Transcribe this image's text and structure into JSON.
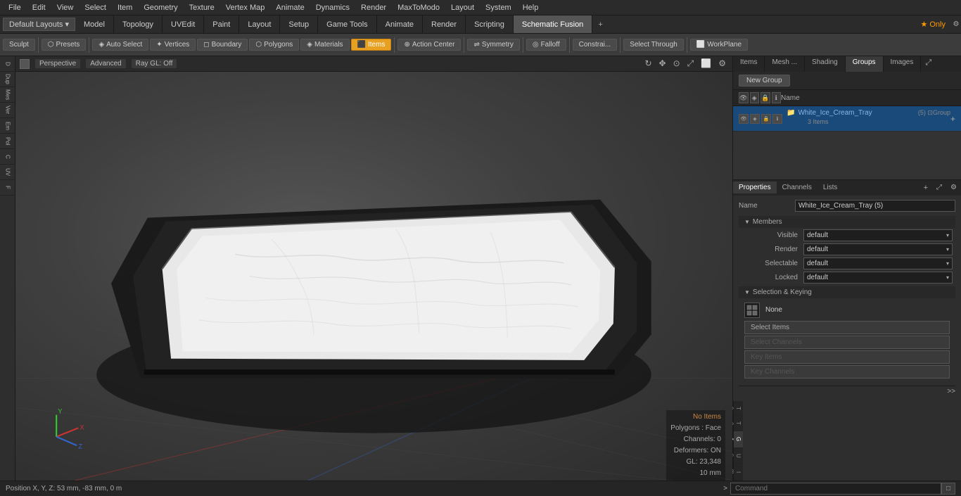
{
  "menu": {
    "items": [
      "File",
      "Edit",
      "View",
      "Select",
      "Item",
      "Geometry",
      "Texture",
      "Vertex Map",
      "Animate",
      "Dynamics",
      "Render",
      "MaxToModo",
      "Layout",
      "System",
      "Help"
    ]
  },
  "layout": {
    "selector_label": "Default Layouts ▾",
    "tabs": [
      "Model",
      "Topology",
      "UVEdit",
      "Paint",
      "Layout",
      "Setup",
      "Game Tools",
      "Animate",
      "Render",
      "Scripting",
      "Schematic Fusion"
    ],
    "plus_label": "+",
    "star_only": "★ Only"
  },
  "toolbar": {
    "sculpt_label": "Sculpt",
    "presets_label": "Presets",
    "auto_select_label": "Auto Select",
    "vertices_label": "Vertices",
    "boundary_label": "Boundary",
    "polygons_label": "Polygons",
    "materials_label": "Materials",
    "items_label": "Items",
    "action_center_label": "Action Center",
    "symmetry_label": "Symmetry",
    "falloff_label": "Falloff",
    "constraint_label": "Constrai...",
    "select_through_label": "Select Through",
    "workplane_label": "WorkPlane"
  },
  "viewport": {
    "perspective_label": "Perspective",
    "advanced_label": "Advanced",
    "ray_gl_label": "Ray GL: Off",
    "status": {
      "no_items": "No Items",
      "polygons": "Polygons : Face",
      "channels": "Channels: 0",
      "deformers": "Deformers: ON",
      "gl": "GL: 23,348",
      "scale": "10 mm"
    }
  },
  "left_sidebar": {
    "items": [
      "D",
      "Dup",
      "Mes",
      "Ver",
      "Em",
      "Pol",
      "C",
      "UV",
      "F"
    ]
  },
  "right_panel": {
    "tabs": [
      "Items",
      "Mesh ...",
      "Shading",
      "Groups",
      "Images"
    ],
    "expand_icon": "⤢",
    "new_group_label": "New Group",
    "columns": {
      "name": "Name"
    },
    "groups": [
      {
        "name": "White_Ice_Cream_Tray",
        "suffix": "(5)  Group",
        "items_count": "3 Items"
      }
    ]
  },
  "properties": {
    "tabs": [
      "Properties",
      "Channels",
      "Lists"
    ],
    "plus_label": "+",
    "name_label": "Name",
    "name_value": "White_Ice_Cream_Tray (5)",
    "members_section": "Members",
    "fields": [
      {
        "label": "Visible",
        "value": "default"
      },
      {
        "label": "Render",
        "value": "default"
      },
      {
        "label": "Selectable",
        "value": "default"
      },
      {
        "label": "Locked",
        "value": "default"
      }
    ],
    "keying_section": "Selection & Keying",
    "keying_icon": "▦",
    "keying_none_label": "None",
    "keying_buttons": [
      {
        "label": "Select Items",
        "enabled": true
      },
      {
        "label": "Select Channels",
        "enabled": false
      },
      {
        "label": "Key Items",
        "enabled": false
      },
      {
        "label": "Key Channels",
        "enabled": false
      }
    ]
  },
  "right_vtabs": {
    "items": [
      "Texture...",
      "Texture...",
      "Group",
      "User C...",
      "Ima..."
    ]
  },
  "bottom": {
    "position_status": "Position X, Y, Z:  53 mm, -83 mm, 0 m",
    "command_arrow": ">",
    "command_placeholder": "Command",
    "submit_icon": "□"
  }
}
